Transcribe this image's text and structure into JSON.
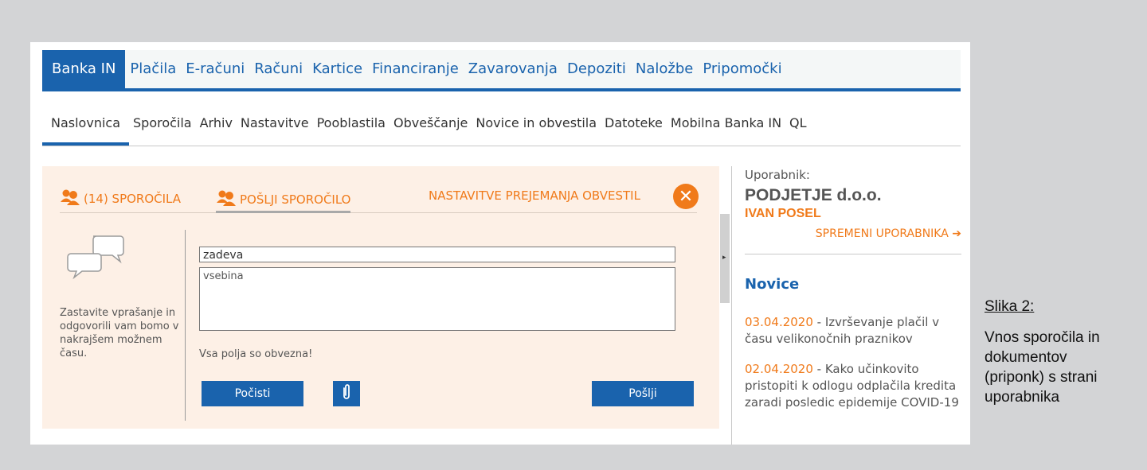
{
  "top_nav": {
    "items": [
      "Banka IN",
      "Plačila",
      "E-računi",
      "Računi",
      "Kartice",
      "Financiranje",
      "Zavarovanja",
      "Depoziti",
      "Naložbe",
      "Pripomočki"
    ],
    "active": "Banka IN"
  },
  "sub_nav": {
    "items": [
      "Naslovnica",
      "Sporočila",
      "Arhiv",
      "Nastavitve",
      "Pooblastila",
      "Obveščanje",
      "Novice in obvestila",
      "Datoteke",
      "Mobilna Banka IN",
      "QL"
    ],
    "active": "Naslovnica"
  },
  "message_panel": {
    "tabs": {
      "inbox": "(14) SPOROČILA",
      "send": "POŠLJI SPOROČILO",
      "settings": "NASTAVITVE PREJEMANJA OBVESTIL"
    },
    "help_text": "Zastavite vprašanje in odgovorili vam bomo v nakrajšem možnem času.",
    "subject_value": "zadeva",
    "body_placeholder": "vsebina",
    "required_note": "Vsa polja so obvezna!",
    "clear_button": "Počisti",
    "send_button": "Pošlji"
  },
  "user_panel": {
    "label": "Uporabnik:",
    "company": "PODJETJE d.o.o.",
    "name": "IVAN POSEL",
    "change_link": "SPREMENI UPORABNIKA"
  },
  "news": {
    "title": "Novice",
    "items": [
      {
        "date": "03.04.2020",
        "text": " - Izvrševanje plačil v času velikonočnih praznikov"
      },
      {
        "date": "02.04.2020",
        "text": " - Kako učinkovito pristopiti k odlogu odplačila kredita zaradi posledic epidemije COVID-19"
      }
    ]
  },
  "caption": {
    "label": "Slika 2:",
    "text": "Vnos sporočila in dokumentov (priponk) s strani uporabnika"
  },
  "colors": {
    "brand_blue": "#1a63ad",
    "accent_orange": "#f07a1a",
    "panel_bg": "#fdf0e6"
  },
  "icons": [
    "users-icon",
    "chat-bubbles-icon",
    "close-icon",
    "paperclip-icon",
    "arrow-right-icon",
    "collapse-arrow-icon"
  ]
}
